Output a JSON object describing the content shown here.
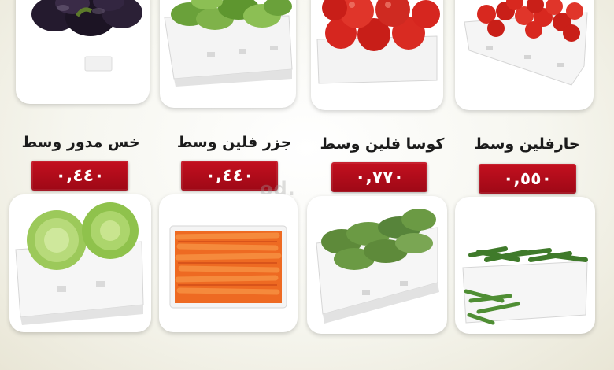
{
  "products": [
    {
      "name": "خس مدور وسط",
      "price": "٠,٤٤٠",
      "image": "lettuce-box"
    },
    {
      "name": "جزر فلين وسط",
      "price": "٠,٤٤٠",
      "image": "carrot-box"
    },
    {
      "name": "كوسا فلين وسط",
      "price": "٠,٧٧٠",
      "image": "zucchini-box"
    },
    {
      "name": "حارفلين وسط",
      "price": "٠,٥٥٠",
      "image": "chili-box"
    }
  ],
  "top_row_images": [
    "eggplant",
    "cucumber-box",
    "tomato-box",
    "tomato-box"
  ],
  "watermark": "od."
}
